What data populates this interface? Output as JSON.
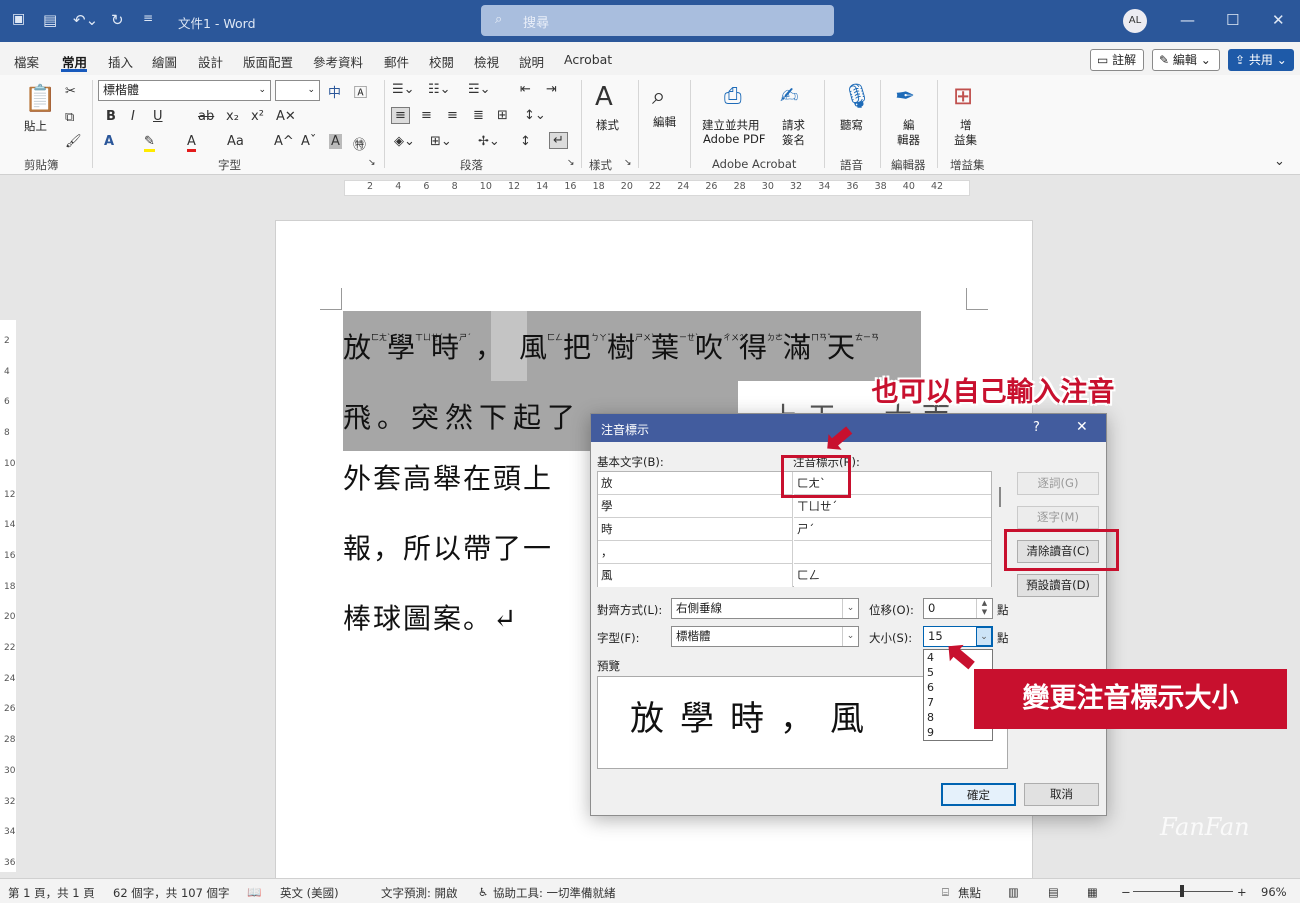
{
  "titlebar": {
    "doc_title": "文件1 - Word",
    "search_placeholder": "搜尋",
    "avatar_initials": "AL"
  },
  "menu": {
    "tabs": [
      "檔案",
      "常用",
      "插入",
      "繪圖",
      "設計",
      "版面配置",
      "參考資料",
      "郵件",
      "校閱",
      "檢視",
      "說明",
      "Acrobat"
    ],
    "active_tab": "常用",
    "comment_btn": "註解",
    "edit_btn": "編輯",
    "share_btn": "共用"
  },
  "ribbon": {
    "paste_label": "貼上",
    "font_name": "標楷體",
    "font_size": "",
    "styles_label": "樣式",
    "edit_label": "編輯",
    "create_pdf_label_1": "建立並共用",
    "create_pdf_label_2": "Adobe PDF",
    "request_sign_label_1": "請求",
    "request_sign_label_2": "簽名",
    "dictate_label": "聽寫",
    "editor_label_1": "編",
    "editor_label_2": "輯器",
    "addins_label_1": "增",
    "addins_label_2": "益集",
    "groups": {
      "clipboard": "剪貼簿",
      "font": "字型",
      "paragraph": "段落",
      "styles": "樣式",
      "acrobat": "Adobe Acrobat",
      "voice": "語音",
      "editor": "編輯器",
      "addins": "增益集"
    }
  },
  "ruler": {
    "ticks": [
      "2",
      "4",
      "6",
      "8",
      "10",
      "12",
      "14",
      "16",
      "18",
      "20",
      "22",
      "24",
      "26",
      "28",
      "30",
      "32",
      "34",
      "36",
      "38",
      "40",
      "42"
    ]
  },
  "vruler": {
    "ticks": [
      "2",
      "4",
      "6",
      "8",
      "10",
      "12",
      "14",
      "16",
      "18",
      "20",
      "22",
      "24",
      "26",
      "28",
      "30",
      "32",
      "34",
      "36"
    ]
  },
  "document": {
    "line1": "放學時，風把樹葉吹得滿天",
    "line1_zhuyin": [
      "ㄈㄤˋ",
      "ㄒㄩㄝˊ",
      "ㄕˊ",
      "",
      "ㄈㄥ",
      "ㄅㄚˇ",
      "ㄕㄨˋ",
      "ㄧㄝˋ",
      "ㄔㄨㄟ",
      "ㄉㄜˊ",
      "ㄇㄢˇ",
      "ㄊㄧㄢ"
    ],
    "line2": "飛。突然下起了",
    "line2_tail": "上天一大雨",
    "line3": "外套高舉在頭上",
    "line4": "報，所以帶了一",
    "line5": "棒球圖案。↵"
  },
  "dialog": {
    "title": "注音標示",
    "help": "?",
    "base_text_label": "基本文字(B):",
    "ruby_text_label": "注音標示(R):",
    "rows": [
      {
        "base": "放",
        "ruby": "ㄈㄤˋ"
      },
      {
        "base": "學",
        "ruby": "ㄒㄩㄝˊ"
      },
      {
        "base": "時",
        "ruby": "ㄕˊ"
      },
      {
        "base": "，",
        "ruby": ""
      },
      {
        "base": "風",
        "ruby": "ㄈㄥ"
      }
    ],
    "btn_group": "逐詞(G)",
    "btn_mono": "逐字(M)",
    "btn_clear": "清除讀音(C)",
    "btn_default": "預設讀音(D)",
    "align_label": "對齊方式(L):",
    "align_value": "右側垂線",
    "offset_label": "位移(O):",
    "offset_value": "0",
    "font_label": "字型(F):",
    "font_value": "標楷體",
    "size_label": "大小(S):",
    "size_value": "15",
    "unit": "點",
    "size_options": [
      "4",
      "5",
      "6",
      "7",
      "8",
      "9"
    ],
    "preview_label": "預覽",
    "preview_text": "放學時，風",
    "ok": "確定",
    "cancel": "取消"
  },
  "callouts": {
    "top": "也可以自己輸入注音",
    "bottom": "變更注音標示大小"
  },
  "status": {
    "page": "第 1 頁，共 1 頁",
    "words": "62 個字，共 107 個字",
    "lang": "英文 (美國)",
    "predict": "文字預測: 開啟",
    "access": "協助工具: 一切準備就緒",
    "focus": "焦點",
    "zoom": "96%"
  },
  "watermark": "FanFan"
}
